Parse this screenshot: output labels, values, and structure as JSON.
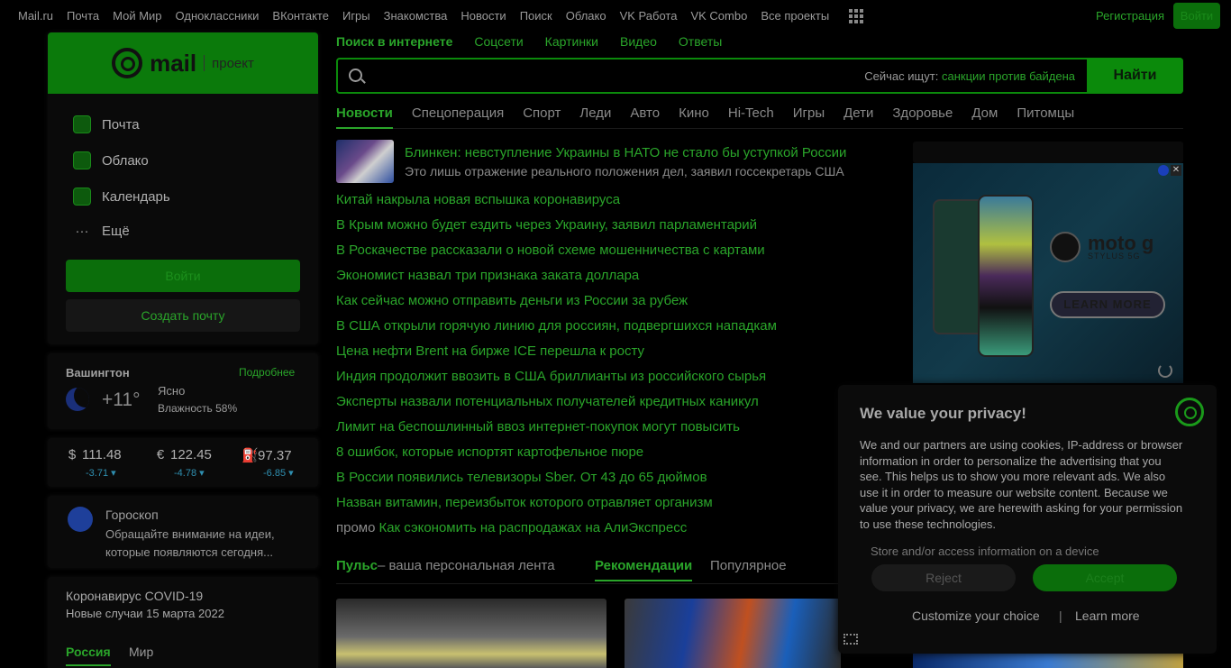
{
  "topnav": {
    "items": [
      "Mail.ru",
      "Почта",
      "Мой Мир",
      "Одноклассники",
      "ВКонтакте",
      "Игры",
      "Знакомства",
      "Новости",
      "Поиск",
      "Облако",
      "VK Работа",
      "VK Combo",
      "Все проекты"
    ],
    "register": "Регистрация",
    "login": "Войти"
  },
  "brand": {
    "mail": "mail",
    "project": "проект"
  },
  "services": [
    {
      "label": "Почта",
      "icon": "mail-icon"
    },
    {
      "label": "Облако",
      "icon": "cloud-icon"
    },
    {
      "label": "Календарь",
      "icon": "calendar-icon"
    },
    {
      "label": "Ещё",
      "icon": "more-dots-icon"
    }
  ],
  "auth": {
    "login": "Войти",
    "create": "Создать почту"
  },
  "weather": {
    "city": "Вашингтон",
    "more": "Подробнее",
    "temp": "+11°",
    "condition": "Ясно",
    "humidity": "Влажность 58%"
  },
  "currencies": [
    {
      "symbol": "$",
      "value": "111.48",
      "delta": "-3.71 ▾"
    },
    {
      "symbol": "€",
      "value": "122.45",
      "delta": "-4.78 ▾"
    },
    {
      "symbol": "⛽",
      "value": "97.37",
      "delta": "-6.85 ▾"
    }
  ],
  "horoscope": {
    "title": "Гороскоп",
    "text": "Обращайте внимание на идеи, которые появляются сегодня..."
  },
  "covid": {
    "title": "Коронавирус COVID-19",
    "subtitle": "Новые случаи 15 марта 2022",
    "tabs": [
      "Россия",
      "Мир"
    ]
  },
  "search": {
    "tabs": [
      "Поиск в интернете",
      "Соцсети",
      "Картинки",
      "Видео",
      "Ответы"
    ],
    "hint_label": "Сейчас ищут:",
    "hint_query": "санкции против байдена",
    "button": "Найти"
  },
  "news_tabs": [
    "Новости",
    "Спецоперация",
    "Спорт",
    "Леди",
    "Авто",
    "Кино",
    "Hi-Tech",
    "Игры",
    "Дети",
    "Здоровье",
    "Дом",
    "Питомцы"
  ],
  "lead": {
    "title": "Блинкен: невступление Украины в НАТО не стало бы уступкой России",
    "subtitle": "Это лишь отражение реального положения дел, заявил госсекретарь США"
  },
  "news": [
    "Китай накрыла новая вспышка коронавируса",
    "В Крым можно будет ездить через Украину, заявил парламентарий",
    "В Роскачестве рассказали о новой схеме мошенничества с картами",
    "Экономист назвал три признака заката доллара",
    "Как сейчас можно отправить деньги из России за рубеж",
    "В США открыли горячую линию для россиян, подвергшихся нападкам",
    "Цена нефти Brent на бирже ICE перешла к росту",
    "Индия продолжит ввозить в США бриллианты из российского сырья",
    "Эксперты назвали потенциальных получателей кредитных каникул",
    "Лимит на беспошлинный ввоз интернет-покупок могут повысить",
    "8 ошибок, которые испортят картофельное пюре",
    "В России появились телевизоры Sber. От 43 до 65 дюймов",
    "Назван витамин, переизбыток которого отравляет организм"
  ],
  "promo": {
    "tag": "промо",
    "text": "Как сэкономить на распродажах на АлиЭкспресс"
  },
  "pulse": {
    "brand": "Пульс",
    "tagline": "– ваша персональная лента",
    "tabs": [
      "Рекомендации",
      "Популярное"
    ]
  },
  "ad": {
    "brand": "moto g",
    "model": "STYLUS 5G",
    "cta": "LEARN MORE"
  },
  "privacy": {
    "title": "We value your privacy!",
    "text": "We and our partners are using cookies, IP-address or browser information in order to personalize the advertising that you see. This helps us to show you more relevant ads. We also use it in order to measure our website content. Because we value your privacy, we are herewith asking for your permission to use these technologies.",
    "sub": "Store and/or access information on a device",
    "reject": "Reject",
    "accept": "Accept",
    "customize": "Customize your choice",
    "separator": "|",
    "learn": "Learn more"
  }
}
